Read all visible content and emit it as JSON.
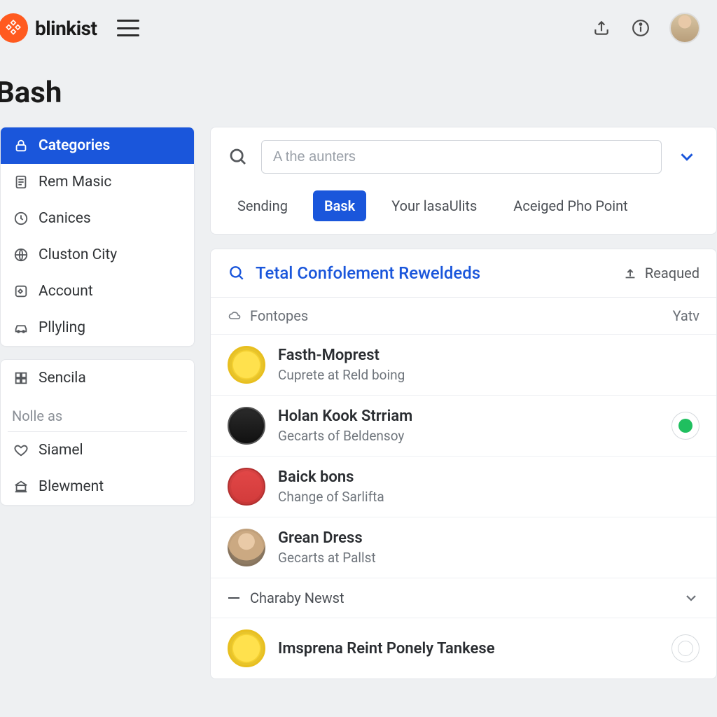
{
  "brand": {
    "name": "blinkist"
  },
  "page_title": "Bash",
  "search": {
    "placeholder": "A the aunters",
    "tabs": [
      {
        "label": "Sending"
      },
      {
        "label": "Bask"
      },
      {
        "label": "Your lasaUlits"
      },
      {
        "label": "Aceiged Pho Point"
      }
    ],
    "active_tab_index": 1
  },
  "sidebar": {
    "group1": [
      {
        "label": "Categories",
        "icon": "lock-icon"
      },
      {
        "label": "Rem Masic",
        "icon": "document-icon"
      },
      {
        "label": "Canices",
        "icon": "clock-icon"
      },
      {
        "label": "Cluston City",
        "icon": "globe-icon"
      },
      {
        "label": "Account",
        "icon": "square-icon"
      },
      {
        "label": "Pllyling",
        "icon": "car-icon"
      }
    ],
    "active_index": 0,
    "group2_header": "Nolle as",
    "group2_first": {
      "label": "Sencila",
      "icon": "grid-icon"
    },
    "group2": [
      {
        "label": "Siamel",
        "icon": "heart-icon"
      },
      {
        "label": "Blewment",
        "icon": "bank-icon"
      }
    ]
  },
  "results": {
    "header_title": "Tetal Confolement Reweldeds",
    "header_action": "Reaqued",
    "column_left": "Fontopes",
    "column_right": "Yatv",
    "rows": [
      {
        "title": "Fasth-Moprest",
        "subtitle": "Cuprete at Reld boing",
        "cover": "cover-yellow",
        "status": null
      },
      {
        "title": "Holan Kook Strriam",
        "subtitle": "Gecarts of Beldensoy",
        "cover": "cover-dark",
        "status": "green"
      },
      {
        "title": "Baick bons",
        "subtitle": "Change of Sarlifta",
        "cover": "cover-red",
        "status": null
      },
      {
        "title": "Grean Dress",
        "subtitle": "Gecarts at Pallst",
        "cover": "cover-face",
        "status": null
      }
    ],
    "expander_label": "Charaby Newst",
    "last_row": {
      "title": "Imsprena Reint Ponely Tankese",
      "subtitle": "",
      "cover": "cover-yellow",
      "status": "empty"
    }
  }
}
